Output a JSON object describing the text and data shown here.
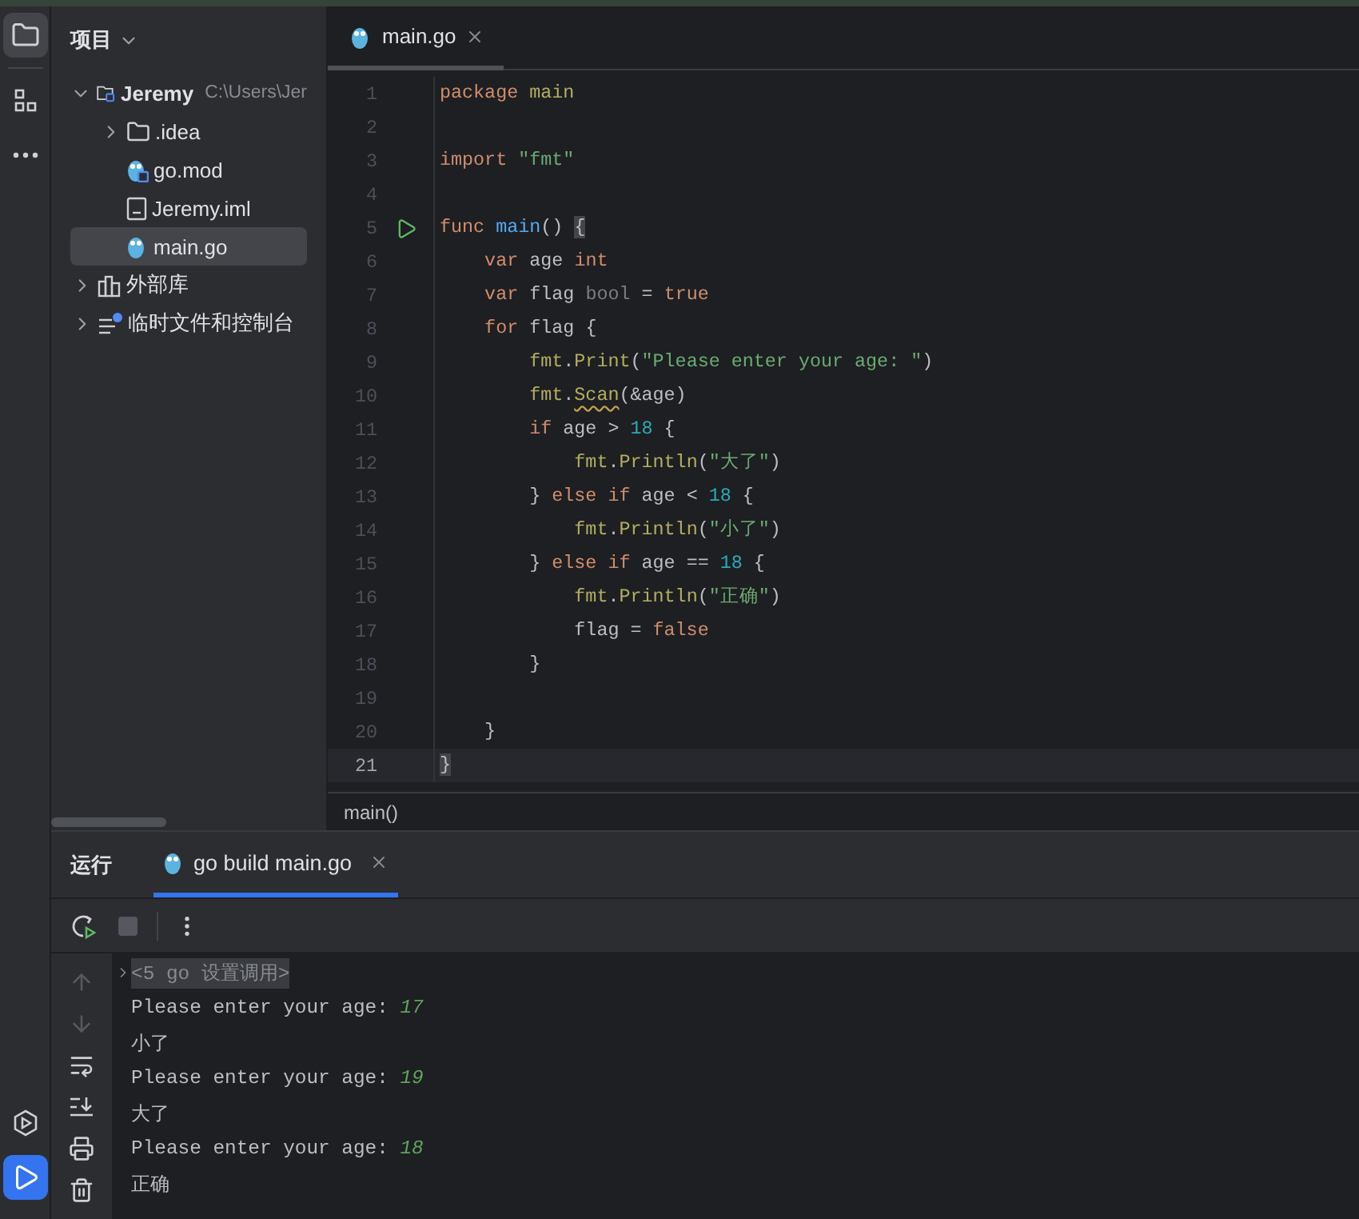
{
  "tool_strip": {
    "top": [
      {
        "kind": "project",
        "selected": true
      },
      {
        "kind": "structure",
        "selected": false
      },
      {
        "kind": "more",
        "selected": false
      }
    ],
    "bottom": [
      {
        "kind": "services",
        "selected": false
      },
      {
        "kind": "run",
        "selected": true
      }
    ]
  },
  "project_panel": {
    "title": "项目",
    "tree": [
      {
        "label": "Jeremy",
        "path": "C:\\Users\\Jer",
        "kind": "module",
        "expanded": true,
        "selected": false,
        "children": [
          {
            "label": ".idea",
            "kind": "folder",
            "expanded": false,
            "selected": false
          },
          {
            "label": "go.mod",
            "kind": "gomod",
            "selected": false
          },
          {
            "label": "Jeremy.iml",
            "kind": "iml",
            "selected": false
          },
          {
            "label": "main.go",
            "kind": "gofile",
            "selected": true
          }
        ]
      },
      {
        "label": "外部库",
        "kind": "library",
        "expanded": false,
        "selected": false
      },
      {
        "label": "临时文件和控制台",
        "kind": "scratch",
        "expanded": false,
        "selected": false
      }
    ]
  },
  "editor": {
    "tabs": [
      {
        "label": "main.go",
        "selected": true
      }
    ],
    "lines": [
      {
        "number": "1",
        "tokens": [
          {
            "text": "package",
            "kind": "keyword"
          },
          {
            "text": " main",
            "kind": "package"
          }
        ]
      },
      {
        "number": "2"
      },
      {
        "number": "3",
        "tokens": [
          {
            "text": "import",
            "kind": "keyword"
          },
          {
            "text": " \"fmt\"",
            "kind": "string"
          }
        ]
      },
      {
        "number": "4"
      },
      {
        "number": "5",
        "runnable": true,
        "tokens": [
          {
            "text": "func",
            "kind": "keyword"
          },
          {
            "text": " main",
            "kind": "function"
          },
          {
            "text": "() "
          },
          {
            "text": "{",
            "kind": "brace-match"
          }
        ]
      },
      {
        "number": "6",
        "tokens": [
          {
            "text": "    var",
            "kind": "keyword"
          },
          {
            "text": " age "
          },
          {
            "text": "int",
            "kind": "keyword"
          }
        ]
      },
      {
        "number": "7",
        "tokens": [
          {
            "text": "    var",
            "kind": "keyword"
          },
          {
            "text": " flag "
          },
          {
            "text": "bool",
            "kind": "type"
          },
          {
            "text": " = "
          },
          {
            "text": "true",
            "kind": "keyword"
          }
        ]
      },
      {
        "number": "8",
        "tokens": [
          {
            "text": "    for",
            "kind": "keyword"
          },
          {
            "text": " flag {"
          }
        ]
      },
      {
        "number": "9",
        "tokens": [
          {
            "text": "        fmt",
            "kind": "package"
          },
          {
            "text": "."
          },
          {
            "text": "Print",
            "kind": "call"
          },
          {
            "text": "("
          },
          {
            "text": "\"Please enter your age: \"",
            "kind": "string"
          },
          {
            "text": ")"
          }
        ]
      },
      {
        "number": "10",
        "tokens": [
          {
            "text": "        fmt",
            "kind": "package"
          },
          {
            "text": "."
          },
          {
            "text": "Scan",
            "kind": "call",
            "warning": true
          },
          {
            "text": "(&age)"
          }
        ]
      },
      {
        "number": "11",
        "tokens": [
          {
            "text": "        if",
            "kind": "keyword"
          },
          {
            "text": " age > "
          },
          {
            "text": "18",
            "kind": "number"
          },
          {
            "text": " {"
          }
        ]
      },
      {
        "number": "12",
        "tokens": [
          {
            "text": "            fmt",
            "kind": "package"
          },
          {
            "text": "."
          },
          {
            "text": "Println",
            "kind": "call"
          },
          {
            "text": "("
          },
          {
            "text": "\"大了\"",
            "kind": "string"
          },
          {
            "text": ")"
          }
        ]
      },
      {
        "number": "13",
        "tokens": [
          {
            "text": "        } "
          },
          {
            "text": "else if",
            "kind": "keyword"
          },
          {
            "text": " age < "
          },
          {
            "text": "18",
            "kind": "number"
          },
          {
            "text": " {"
          }
        ]
      },
      {
        "number": "14",
        "tokens": [
          {
            "text": "            fmt",
            "kind": "package"
          },
          {
            "text": "."
          },
          {
            "text": "Println",
            "kind": "call"
          },
          {
            "text": "("
          },
          {
            "text": "\"小了\"",
            "kind": "string"
          },
          {
            "text": ")"
          }
        ]
      },
      {
        "number": "15",
        "tokens": [
          {
            "text": "        } "
          },
          {
            "text": "else if",
            "kind": "keyword"
          },
          {
            "text": " age == "
          },
          {
            "text": "18",
            "kind": "number"
          },
          {
            "text": " {"
          }
        ]
      },
      {
        "number": "16",
        "tokens": [
          {
            "text": "            fmt",
            "kind": "package"
          },
          {
            "text": "."
          },
          {
            "text": "Println",
            "kind": "call"
          },
          {
            "text": "("
          },
          {
            "text": "\"正确\"",
            "kind": "string"
          },
          {
            "text": ")"
          }
        ]
      },
      {
        "number": "17",
        "tokens": [
          {
            "text": "            flag = "
          },
          {
            "text": "false",
            "kind": "keyword"
          }
        ]
      },
      {
        "number": "18",
        "tokens": [
          {
            "text": "        }"
          }
        ]
      },
      {
        "number": "19"
      },
      {
        "number": "20",
        "tokens": [
          {
            "text": "    }"
          }
        ]
      },
      {
        "number": "21",
        "current": true,
        "tokens": [
          {
            "text": "}",
            "kind": "brace-match"
          }
        ]
      }
    ],
    "breadcrumb": "main()"
  },
  "run_panel": {
    "title": "运行",
    "tabs": [
      {
        "label": "go build main.go",
        "selected": true
      }
    ],
    "toolbar": [
      {
        "kind": "rerun",
        "disabled": false
      },
      {
        "kind": "stop",
        "disabled": true
      },
      {
        "kind": "more",
        "disabled": false
      }
    ],
    "side_actions": [
      {
        "kind": "up",
        "disabled": true
      },
      {
        "kind": "down",
        "disabled": true
      },
      {
        "kind": "wrap",
        "disabled": false
      },
      {
        "kind": "scroll-end",
        "disabled": false
      },
      {
        "kind": "print",
        "disabled": false
      },
      {
        "kind": "delete",
        "disabled": false
      }
    ],
    "console": [
      {
        "kind": "folded",
        "text": "<5 go 设置调用>"
      },
      {
        "kind": "prompt",
        "text": "Please enter your age: ",
        "input": "17"
      },
      {
        "kind": "output",
        "text": "小了"
      },
      {
        "kind": "prompt",
        "text": "Please enter your age: ",
        "input": "19"
      },
      {
        "kind": "output",
        "text": "大了"
      },
      {
        "kind": "prompt",
        "text": "Please enter your age: ",
        "input": "18"
      },
      {
        "kind": "output",
        "text": "正确"
      }
    ]
  }
}
